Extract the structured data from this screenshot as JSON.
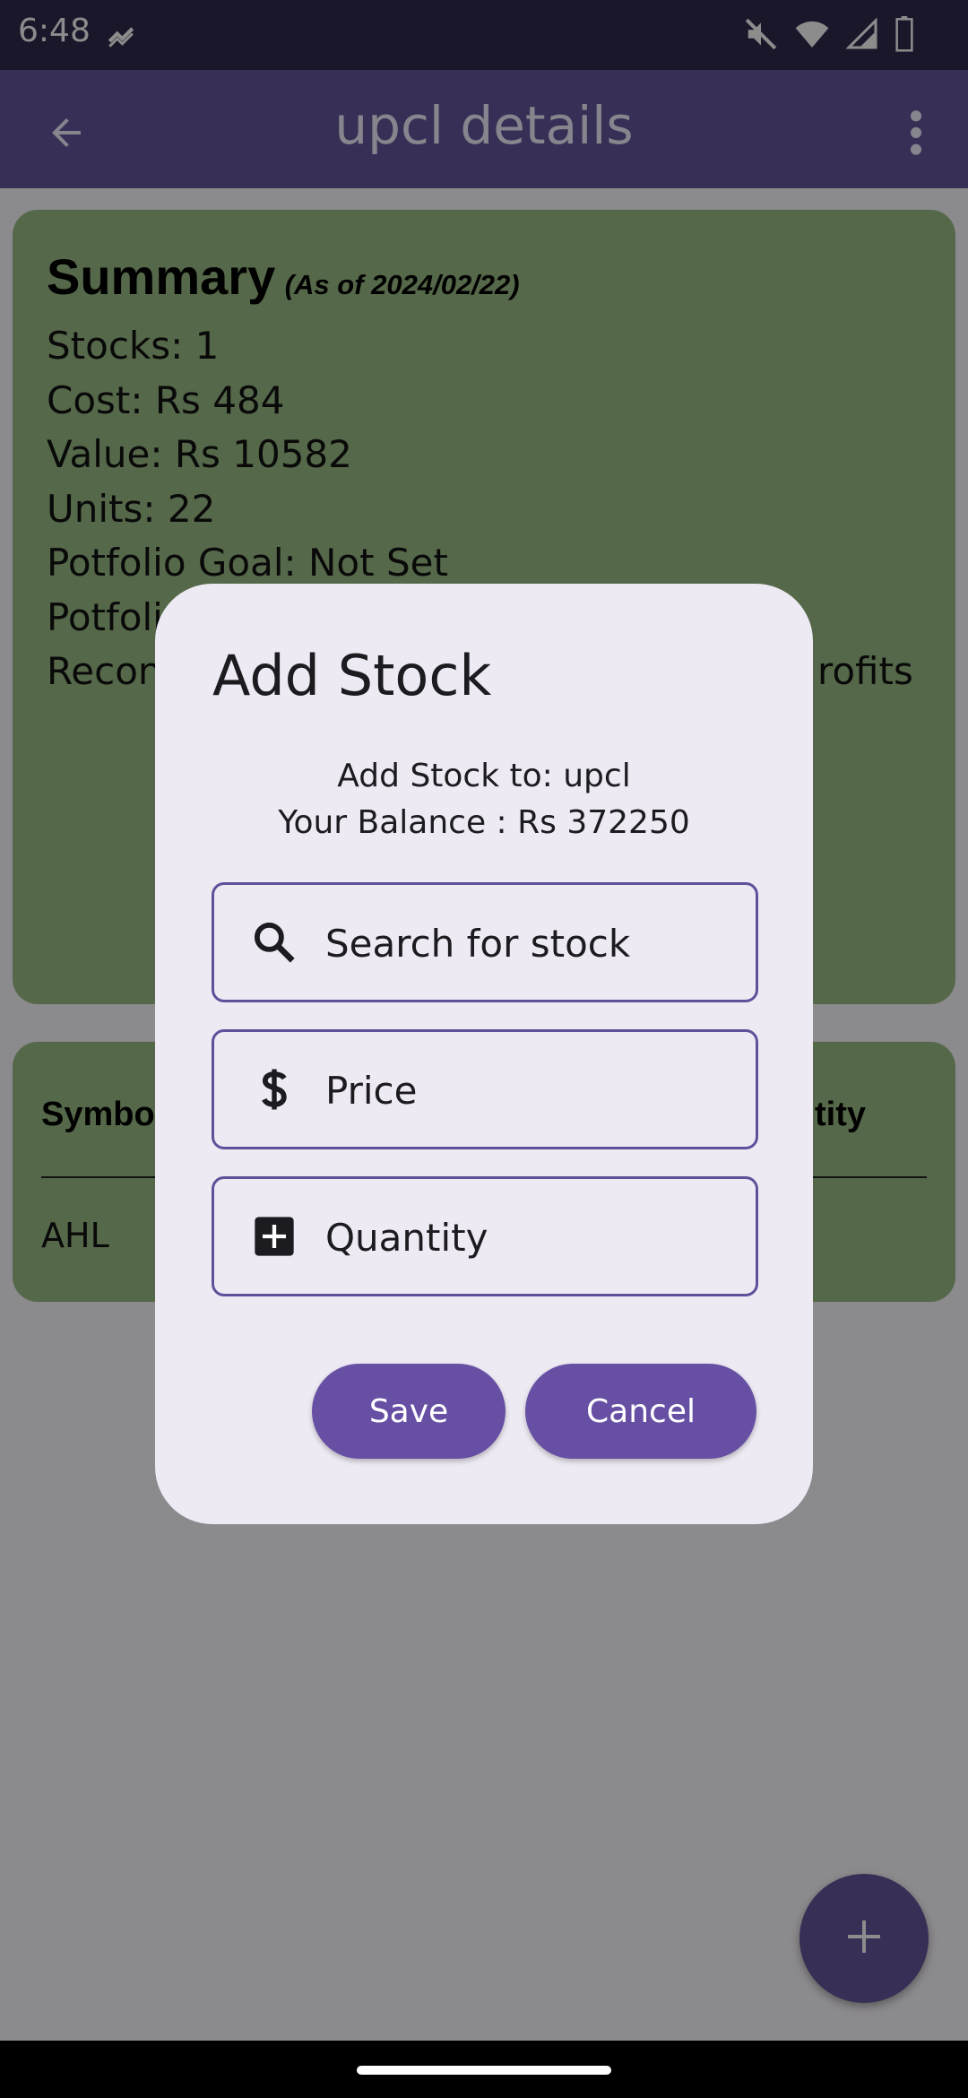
{
  "status_bar": {
    "time": "6:48"
  },
  "app_bar": {
    "title": "upcl details"
  },
  "summary": {
    "title": "Summary",
    "date": "(As of 2024/02/22)",
    "lines": [
      "Stocks: 1",
      "Cost: Rs 484",
      "Value: Rs 10582",
      "Units: 22",
      "Potfolio Goal: Not Set",
      "Potfolio",
      "Recon"
    ],
    "line_fragment_right": "rofits"
  },
  "table": {
    "header_symbol": "Symbo",
    "header_quantity": "ntity",
    "rows": [
      {
        "symbol": "AHL"
      }
    ]
  },
  "dialog": {
    "title": "Add Stock",
    "add_to_label": "Add Stock to:  upcl",
    "balance_label": "Your Balance : Rs 372250",
    "search_placeholder": "Search for stock",
    "price_placeholder": "Price",
    "quantity_placeholder": "Quantity",
    "save_label": "Save",
    "cancel_label": "Cancel"
  },
  "icons": {
    "back": "arrow-back-icon",
    "more": "more-vert-icon",
    "search": "search-icon",
    "price": "dollar-icon",
    "quantity": "add-box-icon",
    "fab": "add-icon"
  },
  "colors": {
    "app_bar": "#64579d",
    "status_bar": "#322a4f",
    "card": "#9bbe86",
    "dialog_bg": "#eeeaf4",
    "field_border": "#5e519a",
    "button": "#6750a4"
  }
}
